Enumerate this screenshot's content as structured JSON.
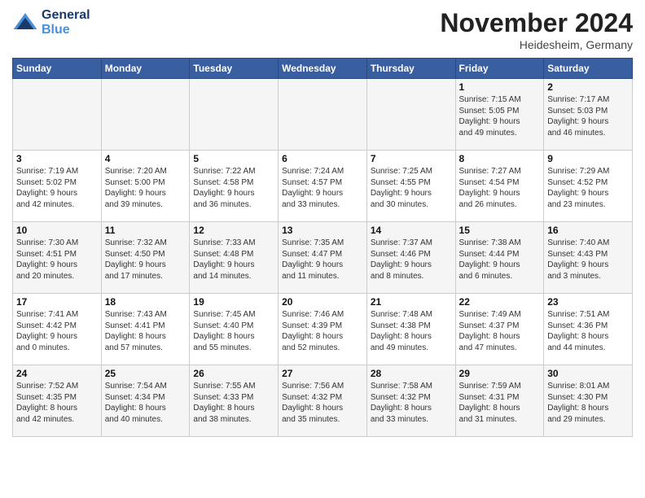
{
  "header": {
    "title": "November 2024",
    "location": "Heidesheim, Germany"
  },
  "logo": {
    "line1": "General",
    "line2": "Blue"
  },
  "days": [
    "Sunday",
    "Monday",
    "Tuesday",
    "Wednesday",
    "Thursday",
    "Friday",
    "Saturday"
  ],
  "weeks": [
    [
      {
        "num": "",
        "info": ""
      },
      {
        "num": "",
        "info": ""
      },
      {
        "num": "",
        "info": ""
      },
      {
        "num": "",
        "info": ""
      },
      {
        "num": "",
        "info": ""
      },
      {
        "num": "1",
        "info": "Sunrise: 7:15 AM\nSunset: 5:05 PM\nDaylight: 9 hours\nand 49 minutes."
      },
      {
        "num": "2",
        "info": "Sunrise: 7:17 AM\nSunset: 5:03 PM\nDaylight: 9 hours\nand 46 minutes."
      }
    ],
    [
      {
        "num": "3",
        "info": "Sunrise: 7:19 AM\nSunset: 5:02 PM\nDaylight: 9 hours\nand 42 minutes."
      },
      {
        "num": "4",
        "info": "Sunrise: 7:20 AM\nSunset: 5:00 PM\nDaylight: 9 hours\nand 39 minutes."
      },
      {
        "num": "5",
        "info": "Sunrise: 7:22 AM\nSunset: 4:58 PM\nDaylight: 9 hours\nand 36 minutes."
      },
      {
        "num": "6",
        "info": "Sunrise: 7:24 AM\nSunset: 4:57 PM\nDaylight: 9 hours\nand 33 minutes."
      },
      {
        "num": "7",
        "info": "Sunrise: 7:25 AM\nSunset: 4:55 PM\nDaylight: 9 hours\nand 30 minutes."
      },
      {
        "num": "8",
        "info": "Sunrise: 7:27 AM\nSunset: 4:54 PM\nDaylight: 9 hours\nand 26 minutes."
      },
      {
        "num": "9",
        "info": "Sunrise: 7:29 AM\nSunset: 4:52 PM\nDaylight: 9 hours\nand 23 minutes."
      }
    ],
    [
      {
        "num": "10",
        "info": "Sunrise: 7:30 AM\nSunset: 4:51 PM\nDaylight: 9 hours\nand 20 minutes."
      },
      {
        "num": "11",
        "info": "Sunrise: 7:32 AM\nSunset: 4:50 PM\nDaylight: 9 hours\nand 17 minutes."
      },
      {
        "num": "12",
        "info": "Sunrise: 7:33 AM\nSunset: 4:48 PM\nDaylight: 9 hours\nand 14 minutes."
      },
      {
        "num": "13",
        "info": "Sunrise: 7:35 AM\nSunset: 4:47 PM\nDaylight: 9 hours\nand 11 minutes."
      },
      {
        "num": "14",
        "info": "Sunrise: 7:37 AM\nSunset: 4:46 PM\nDaylight: 9 hours\nand 8 minutes."
      },
      {
        "num": "15",
        "info": "Sunrise: 7:38 AM\nSunset: 4:44 PM\nDaylight: 9 hours\nand 6 minutes."
      },
      {
        "num": "16",
        "info": "Sunrise: 7:40 AM\nSunset: 4:43 PM\nDaylight: 9 hours\nand 3 minutes."
      }
    ],
    [
      {
        "num": "17",
        "info": "Sunrise: 7:41 AM\nSunset: 4:42 PM\nDaylight: 9 hours\nand 0 minutes."
      },
      {
        "num": "18",
        "info": "Sunrise: 7:43 AM\nSunset: 4:41 PM\nDaylight: 8 hours\nand 57 minutes."
      },
      {
        "num": "19",
        "info": "Sunrise: 7:45 AM\nSunset: 4:40 PM\nDaylight: 8 hours\nand 55 minutes."
      },
      {
        "num": "20",
        "info": "Sunrise: 7:46 AM\nSunset: 4:39 PM\nDaylight: 8 hours\nand 52 minutes."
      },
      {
        "num": "21",
        "info": "Sunrise: 7:48 AM\nSunset: 4:38 PM\nDaylight: 8 hours\nand 49 minutes."
      },
      {
        "num": "22",
        "info": "Sunrise: 7:49 AM\nSunset: 4:37 PM\nDaylight: 8 hours\nand 47 minutes."
      },
      {
        "num": "23",
        "info": "Sunrise: 7:51 AM\nSunset: 4:36 PM\nDaylight: 8 hours\nand 44 minutes."
      }
    ],
    [
      {
        "num": "24",
        "info": "Sunrise: 7:52 AM\nSunset: 4:35 PM\nDaylight: 8 hours\nand 42 minutes."
      },
      {
        "num": "25",
        "info": "Sunrise: 7:54 AM\nSunset: 4:34 PM\nDaylight: 8 hours\nand 40 minutes."
      },
      {
        "num": "26",
        "info": "Sunrise: 7:55 AM\nSunset: 4:33 PM\nDaylight: 8 hours\nand 38 minutes."
      },
      {
        "num": "27",
        "info": "Sunrise: 7:56 AM\nSunset: 4:32 PM\nDaylight: 8 hours\nand 35 minutes."
      },
      {
        "num": "28",
        "info": "Sunrise: 7:58 AM\nSunset: 4:32 PM\nDaylight: 8 hours\nand 33 minutes."
      },
      {
        "num": "29",
        "info": "Sunrise: 7:59 AM\nSunset: 4:31 PM\nDaylight: 8 hours\nand 31 minutes."
      },
      {
        "num": "30",
        "info": "Sunrise: 8:01 AM\nSunset: 4:30 PM\nDaylight: 8 hours\nand 29 minutes."
      }
    ]
  ]
}
